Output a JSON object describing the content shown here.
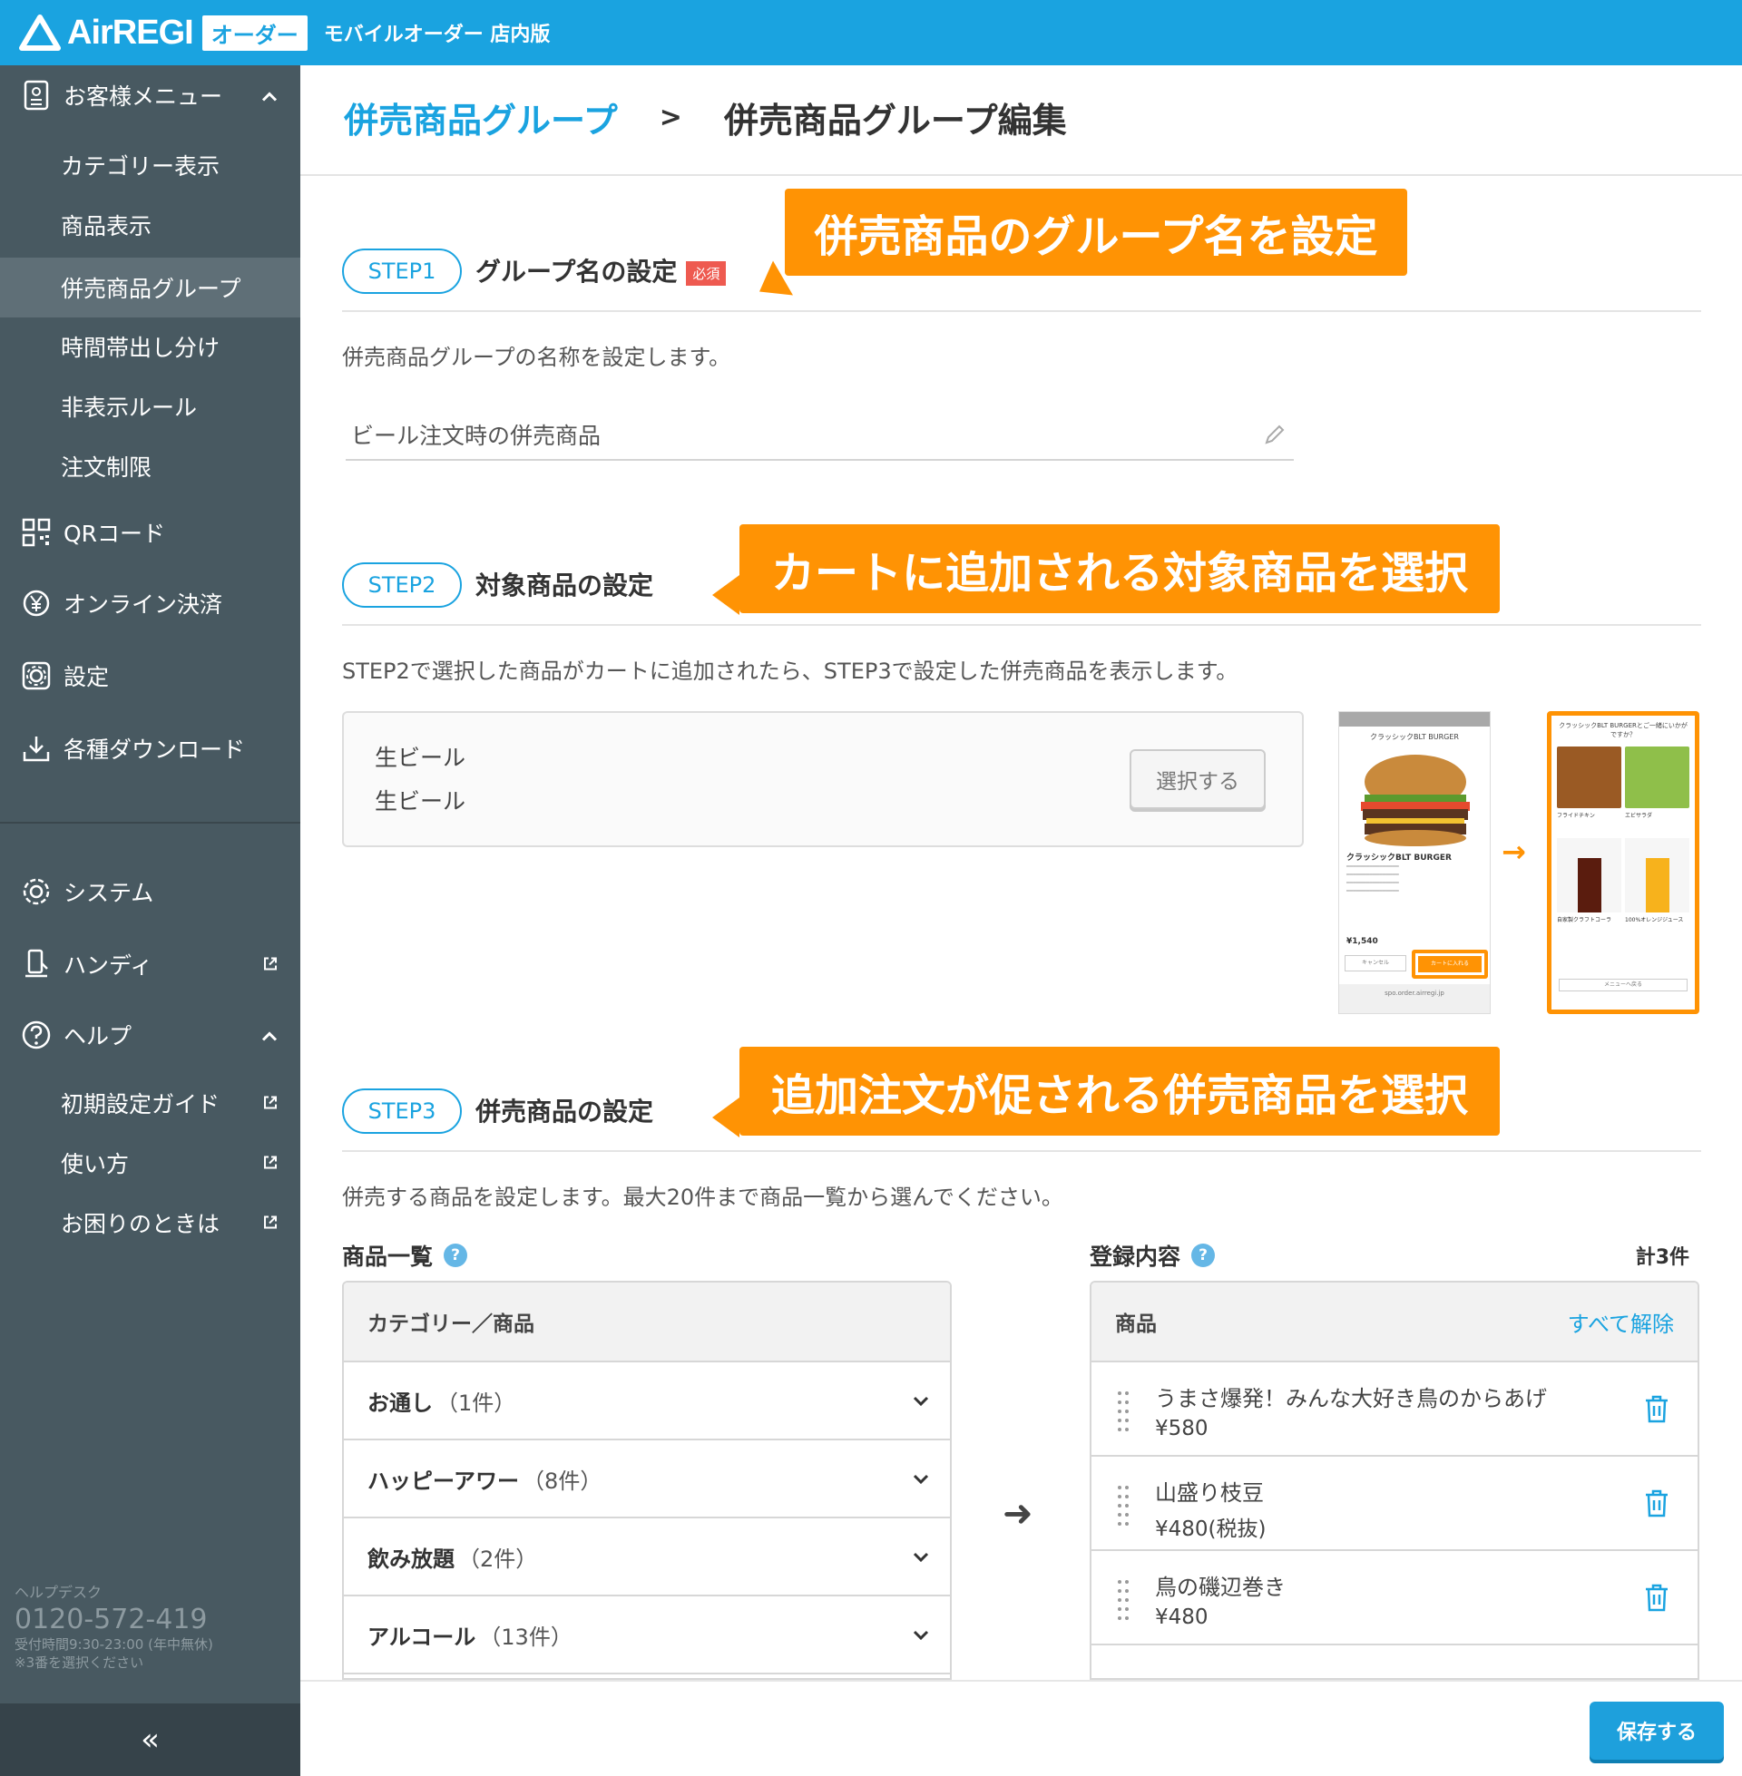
{
  "header": {
    "logo_text": "AirREGI",
    "logo_badge": "オーダー",
    "app_subtitle": "モバイルオーダー 店内版"
  },
  "sidebar": {
    "menu_group": "お客様メニュー",
    "menu_items": [
      {
        "label": "カテゴリー表示"
      },
      {
        "label": "商品表示"
      },
      {
        "label": "併売商品グループ"
      },
      {
        "label": "時間帯出し分け"
      },
      {
        "label": "非表示ルール"
      },
      {
        "label": "注文制限"
      }
    ],
    "qr": "QRコード",
    "online_pay": "オンライン決済",
    "settings": "設定",
    "downloads": "各種ダウンロード",
    "system": "システム",
    "handy": "ハンディ",
    "help": "ヘルプ",
    "help_items": [
      {
        "label": "初期設定ガイド"
      },
      {
        "label": "使い方"
      },
      {
        "label": "お困りのときは"
      }
    ],
    "helpdesk_label": "ヘルプデスク",
    "helpdesk_phone": "0120-572-419",
    "helpdesk_hours": "受付時間9:30-23:00 (年中無休)",
    "helpdesk_note": "※3番を選択ください",
    "collapse_glyph": "«"
  },
  "breadcrumb": {
    "parent": "併売商品グループ",
    "separator": ">",
    "current": "併売商品グループ編集"
  },
  "callouts": {
    "step1": "併売商品のグループ名を設定",
    "step2": "カートに追加される対象商品を選択",
    "step3": "追加注文が促される併売商品を選択"
  },
  "step1": {
    "pill": "STEP1",
    "title": "グループ名の設定",
    "required": "必須",
    "desc": "併売商品グループの名称を設定します。",
    "input_value": "ビール注文時の併売商品"
  },
  "step2": {
    "pill": "STEP2",
    "title": "対象商品の設定",
    "desc": "STEP2で選択した商品がカートに追加されたら、STEP3で設定した併売商品を表示します。",
    "target_line1": "生ビール",
    "target_line2": "生ビール",
    "select_button": "選択する"
  },
  "preview": {
    "phone1_title": "クラッシックBLT BURGER",
    "phone1_caption": "クラッシックBLT BURGER",
    "phone1_price": "¥1,540",
    "phone1_cancel": "キャンセル",
    "phone1_cart": "カートに入れる",
    "phone2_title": "クラッシックBLT BURGERとご一緒にいかがですか？",
    "phone2_items": [
      "フライドチキン",
      "エビサラダ",
      "自家製クラフトコーラ",
      "100%オレンジジュース"
    ],
    "phone2_back": "メニューへ戻る",
    "url": "spo.order.airregi.jp"
  },
  "step3": {
    "pill": "STEP3",
    "title": "併売商品の設定",
    "desc": "併売する商品を設定します。最大20件まで商品一覧から選んでください。",
    "list_heading": "商品一覧",
    "registered_heading": "登録内容",
    "total": "計3件",
    "list_header": "カテゴリー／商品",
    "categories": [
      {
        "name": "お通し",
        "count": "（1件）"
      },
      {
        "name": "ハッピーアワー",
        "count": "（8件）"
      },
      {
        "name": "飲み放題",
        "count": "（2件）"
      },
      {
        "name": "アルコール",
        "count": "（13件）"
      }
    ],
    "registered_header": "商品",
    "clear_all": "すべて解除",
    "registered": [
      {
        "name": "うまさ爆発！みんな大好き鳥のからあげ",
        "price": "¥580"
      },
      {
        "name": "山盛り枝豆",
        "price": "¥480(税抜)"
      },
      {
        "name": "鳥の磯辺巻き",
        "price": "¥480"
      }
    ],
    "move_arrow": "➜"
  },
  "footer": {
    "save": "保存する"
  },
  "colors": {
    "brand_blue": "#1aa3e0",
    "sidebar_bg": "#485961",
    "callout_orange": "#ff9304",
    "required_red": "#ee5a50"
  }
}
